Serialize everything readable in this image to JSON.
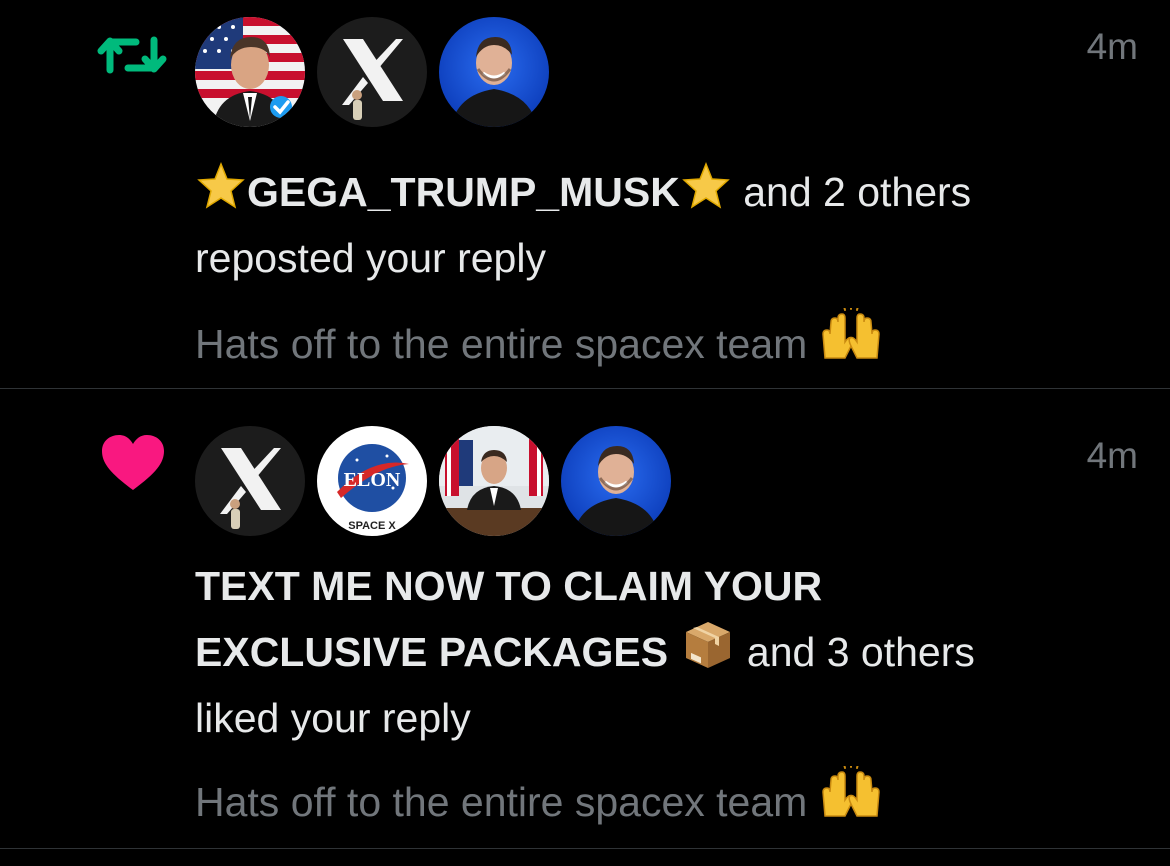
{
  "notifications": [
    {
      "type": "repost",
      "type_icon": "repost-icon",
      "type_color": "#00ba7c",
      "avatars": [
        "avatar-elon-flag",
        "avatar-x-logo",
        "avatar-smiling-man"
      ],
      "timestamp": "4m",
      "actor": "GEGA_TRUMP_MUSK",
      "actor_emojis": [
        "star-emoji",
        "star-emoji"
      ],
      "others": "and 2 others",
      "action": "reposted your reply",
      "quote": "Hats off to the entire spacex team",
      "quote_emoji": "raising-hands-emoji"
    },
    {
      "type": "like",
      "type_icon": "heart-icon",
      "type_color": "#f91880",
      "avatars": [
        "avatar-x-logo",
        "avatar-elon-space-badge",
        "avatar-oval-office",
        "avatar-smiling-man"
      ],
      "timestamp": "4m",
      "actor_line1": "TEXT ME NOW TO CLAIM YOUR",
      "actor_line2": "EXCLUSIVE PACKAGES",
      "actor_emoji": "package-emoji",
      "others": "and 3 others",
      "action": "liked your reply",
      "quote": "Hats off to the entire spacex team",
      "quote_emoji": "raising-hands-emoji",
      "badge_text_top": "ELON",
      "badge_text_bottom": "SPACE X"
    }
  ]
}
